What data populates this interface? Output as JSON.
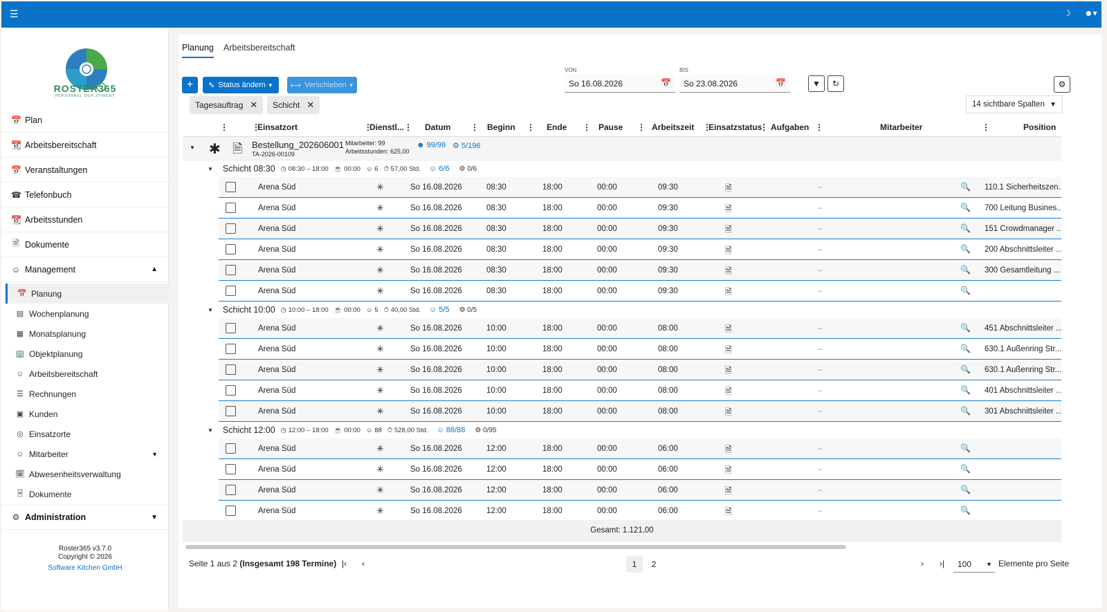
{
  "topbar": {
    "menu_icon": "hamburger-icon",
    "theme_icon": "moon-icon",
    "user_icon": "user-icon"
  },
  "sidebar": {
    "logo_text": "ROSTER365",
    "logo_sub": "PERSONNEL DEPLOYMENT",
    "items": [
      {
        "label": "Plan",
        "icon": "calendar-icon"
      },
      {
        "label": "Arbeitsbereitschaft",
        "icon": "calendar-clock-icon"
      },
      {
        "label": "Veranstaltungen",
        "icon": "calendar-icon"
      },
      {
        "label": "Telefonbuch",
        "icon": "phone-book-icon"
      },
      {
        "label": "Arbeitsstunden",
        "icon": "calendar-clock-icon"
      },
      {
        "label": "Dokumente",
        "icon": "documents-icon"
      },
      {
        "label": "Management",
        "icon": "users-icon"
      }
    ],
    "sub_items": [
      {
        "label": "Planung",
        "icon": "calendar-edit-icon"
      },
      {
        "label": "Wochenplanung",
        "icon": "table-icon"
      },
      {
        "label": "Monatsplanung",
        "icon": "grid-icon"
      },
      {
        "label": "Objektplanung",
        "icon": "building-icon"
      },
      {
        "label": "Arbeitsbereitschaft",
        "icon": "user-clock-icon"
      },
      {
        "label": "Rechnungen",
        "icon": "invoice-icon"
      },
      {
        "label": "Kunden",
        "icon": "briefcase-icon"
      },
      {
        "label": "Einsatzorte",
        "icon": "location-icon"
      },
      {
        "label": "Mitarbeiter",
        "icon": "users-icon"
      },
      {
        "label": "Abwesenheitsverwaltung",
        "icon": "calendar-x-icon"
      },
      {
        "label": "Dokumente",
        "icon": "documents-icon"
      }
    ],
    "admin_label": "Administration",
    "version": "Roster365 v3.7.0",
    "copyright": "Copyright © 2026",
    "company": "Software Kitchen GmbH"
  },
  "tabs": [
    "Planung",
    "Arbeitsbereitschaft"
  ],
  "toolbar": {
    "add_label": "+",
    "status_label": "Status ändern",
    "move_label": "Verschieben",
    "von_label": "VON",
    "von_value": "So 16.08.2026",
    "bis_label": "BIS",
    "bis_value": "So 23.08.2026"
  },
  "chips": [
    "Tagesauftrag",
    "Schicht"
  ],
  "column_select": "14 sichtbare Spalten",
  "headers": [
    "Einsatzort",
    "Dienstl...",
    "Datum",
    "Beginn",
    "Ende",
    "Pause",
    "Arbeitszeit",
    "Einsatzstatus",
    "Aufgaben",
    "Mitarbeiter",
    "Position"
  ],
  "order": {
    "name": "Bestellung_202606001",
    "id": "TA-2026-00109",
    "employees": "Mitarbeiter: 99",
    "hours": "Arbeitsstunden: 625,00",
    "staff": "99/99",
    "tasks": "5/196"
  },
  "shifts": [
    {
      "name": "Schicht 08:30",
      "time": "08:30 – 18:00",
      "pause": "00:00",
      "count": "6",
      "hours": "57,00 Std.",
      "staff": "6/6",
      "tasks": "0/6",
      "rows": [
        {
          "ort": "Arena Süd",
          "datum": "So 16.08.2026",
          "beginn": "08:30",
          "ende": "18:00",
          "pause": "00:00",
          "arbeitszeit": "09:30",
          "aufgaben": "–",
          "position": "110.1 Sicherheitszen..."
        },
        {
          "ort": "Arena Süd",
          "datum": "So 16.08.2026",
          "beginn": "08:30",
          "ende": "18:00",
          "pause": "00:00",
          "arbeitszeit": "09:30",
          "aufgaben": "–",
          "position": "700 Leitung Busines..."
        },
        {
          "ort": "Arena Süd",
          "datum": "So 16.08.2026",
          "beginn": "08:30",
          "ende": "18:00",
          "pause": "00:00",
          "arbeitszeit": "09:30",
          "aufgaben": "–",
          "position": "151 Crowdmanager ..."
        },
        {
          "ort": "Arena Süd",
          "datum": "So 16.08.2026",
          "beginn": "08:30",
          "ende": "18:00",
          "pause": "00:00",
          "arbeitszeit": "09:30",
          "aufgaben": "–",
          "position": "200 Abschnittsleiter ..."
        },
        {
          "ort": "Arena Süd",
          "datum": "So 16.08.2026",
          "beginn": "08:30",
          "ende": "18:00",
          "pause": "00:00",
          "arbeitszeit": "09:30",
          "aufgaben": "–",
          "position": "300 Gesamtleitung ..."
        },
        {
          "ort": "Arena Süd",
          "datum": "So 16.08.2026",
          "beginn": "08:30",
          "ende": "18:00",
          "pause": "00:00",
          "arbeitszeit": "09:30",
          "aufgaben": "–",
          "position": ""
        }
      ]
    },
    {
      "name": "Schicht 10:00",
      "time": "10:00 – 18:00",
      "pause": "00:00",
      "count": "5",
      "hours": "40,00 Std.",
      "staff": "5/5",
      "tasks": "0/5",
      "rows": [
        {
          "ort": "Arena Süd",
          "datum": "So 16.08.2026",
          "beginn": "10:00",
          "ende": "18:00",
          "pause": "00:00",
          "arbeitszeit": "08:00",
          "aufgaben": "–",
          "position": "451 Abschnittsleiter ..."
        },
        {
          "ort": "Arena Süd",
          "datum": "So 16.08.2026",
          "beginn": "10:00",
          "ende": "18:00",
          "pause": "00:00",
          "arbeitszeit": "08:00",
          "aufgaben": "–",
          "position": "630.1 Außenring Str..."
        },
        {
          "ort": "Arena Süd",
          "datum": "So 16.08.2026",
          "beginn": "10:00",
          "ende": "18:00",
          "pause": "00:00",
          "arbeitszeit": "08:00",
          "aufgaben": "–",
          "position": "630.1 Außenring Str..."
        },
        {
          "ort": "Arena Süd",
          "datum": "So 16.08.2026",
          "beginn": "10:00",
          "ende": "18:00",
          "pause": "00:00",
          "arbeitszeit": "08:00",
          "aufgaben": "–",
          "position": "401 Abschnittsleiter ..."
        },
        {
          "ort": "Arena Süd",
          "datum": "So 16.08.2026",
          "beginn": "10:00",
          "ende": "18:00",
          "pause": "00:00",
          "arbeitszeit": "08:00",
          "aufgaben": "–",
          "position": "301 Abschnittsleiter ..."
        }
      ]
    },
    {
      "name": "Schicht 12:00",
      "time": "12:00 – 18:00",
      "pause": "00:00",
      "count": "88",
      "hours": "528,00 Std.",
      "staff": "88/88",
      "tasks": "0/95",
      "rows": [
        {
          "ort": "Arena Süd",
          "datum": "So 16.08.2026",
          "beginn": "12:00",
          "ende": "18:00",
          "pause": "00:00",
          "arbeitszeit": "06:00",
          "aufgaben": "–",
          "position": ""
        },
        {
          "ort": "Arena Süd",
          "datum": "So 16.08.2026",
          "beginn": "12:00",
          "ende": "18:00",
          "pause": "00:00",
          "arbeitszeit": "06:00",
          "aufgaben": "–",
          "position": ""
        },
        {
          "ort": "Arena Süd",
          "datum": "So 16.08.2026",
          "beginn": "12:00",
          "ende": "18:00",
          "pause": "00:00",
          "arbeitszeit": "06:00",
          "aufgaben": "–",
          "position": ""
        },
        {
          "ort": "Arena Süd",
          "datum": "So 16.08.2026",
          "beginn": "12:00",
          "ende": "18:00",
          "pause": "00:00",
          "arbeitszeit": "06:00",
          "aufgaben": "–",
          "position": ""
        }
      ]
    }
  ],
  "total": "Gesamt: 1.121,00",
  "pager": {
    "summary_a": "Seite 1 aus 2 ",
    "summary_b": "(Insgesamt 198 Termine)",
    "pages": [
      "1",
      "2"
    ],
    "per_page": "100",
    "per_page_label": "Elemente pro Seite"
  },
  "colors": {
    "accent": "#0a73c9",
    "row_border": "#1a7bd0"
  }
}
